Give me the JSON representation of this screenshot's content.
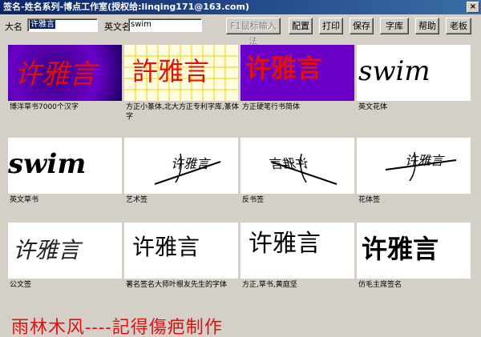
{
  "window": {
    "title": "签名-姓名系列-博点工作室(授权给:linqing171@163.com)",
    "close": "×"
  },
  "form": {
    "cn_name_label": "大名",
    "cn_name_value": "许雅言",
    "en_name_label": "英文名",
    "en_name_value": "swim",
    "input_method_button": "F1鼠标输入法"
  },
  "toolbar": {
    "buttons": [
      "配置",
      "打印",
      "保存",
      "字库",
      "帮助",
      "老板"
    ]
  },
  "styles": [
    {
      "caption": "博洋草书7000个汉字",
      "sample": "许雅言"
    },
    {
      "caption": "方正小篆体,北大方正专利字库,篆体字",
      "sample": "許雅言"
    },
    {
      "caption": "方正硬笔行书简体",
      "sample": "许雅言"
    },
    {
      "caption": "英文花体",
      "sample": "swim"
    },
    {
      "caption": "英文草书",
      "sample": "swim"
    },
    {
      "caption": "艺术签",
      "sample": "许雅言"
    },
    {
      "caption": "反书签",
      "sample": "许雅言"
    },
    {
      "caption": "花体签",
      "sample": "许雅言"
    },
    {
      "caption": "公文签",
      "sample": "许雅言"
    },
    {
      "caption": "著名签名大师叶根友先生的字体",
      "sample": "许雅言"
    },
    {
      "caption": "方正,草书,黄庭坚",
      "sample": "许雅言"
    },
    {
      "caption": "仿毛主席签名",
      "sample": "许雅言"
    }
  ],
  "footer": "雨林木风----記得傷疤制作",
  "colors": {
    "title_start": "#0a246a",
    "accent_red": "#e01010",
    "purple_bg": "#6a00c8"
  }
}
